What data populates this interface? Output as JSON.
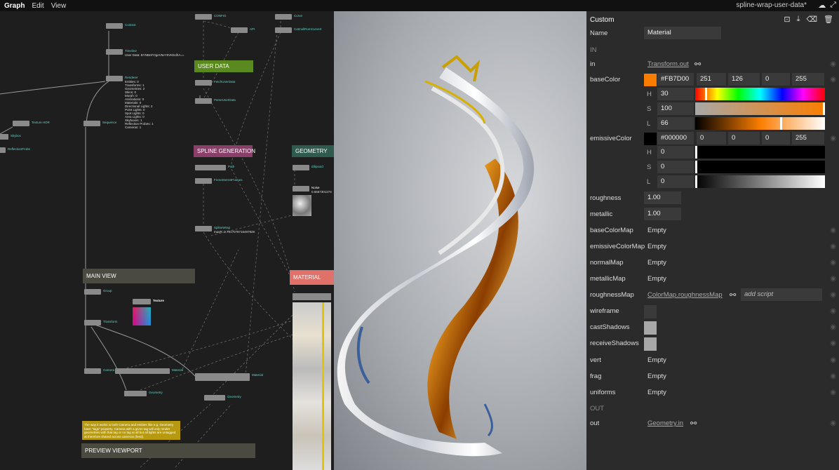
{
  "menu": {
    "graph": "Graph",
    "edit": "Edit",
    "view": "View"
  },
  "document_title": "spline-wrap-user-data*",
  "graph": {
    "groups": {
      "user_data": "USER DATA",
      "spline_generation": "SPLINE GENERATION",
      "geometry": "GEOMETRY",
      "main_view": "MAIN VIEW",
      "material": "MATERIAL",
      "preview_viewport": "PREVIEW VIEWPORT"
    },
    "nodes": {
      "context": "Context",
      "timeline": "Timeline",
      "timeline_info": "User Data: BYNBnFOgeV5eY6VKEdhA==",
      "renderer": "Renderer",
      "renderer_info": "Entities: 0\nTransforms: 1\nGeometries: 2\nSkins: 0\nMorph: 0\nAnimations: 0\nMaterials: 0\nDirectional Lights: 2\nPoint Lights: 0\nSpot Lights: 0\nArea Lights: 0\nSkyboxes: 1\nReflection Probes: 1\nCameras: 1",
      "sequence": "Sequence",
      "texture_hdr": "Texture HDR",
      "skybox": "Skybox",
      "reflection_probe": "ReflectionProbe",
      "config": "CONFIG",
      "api": "API",
      "curve": "Curve",
      "catmull": "CatmullRomCurve3",
      "fetch_user_data": "FetchUserData",
      "parse_user_data": "ParseUserData",
      "path": "Path",
      "frenet": "FrenetSerretFrames",
      "ellipsoid": "Ellipsoid",
      "noise": "Noise",
      "noise_info": "0.6567301274",
      "spline_wrap": "SplineWrap",
      "spline_info": "maxR: 0.7917078716497929",
      "group": "Group",
      "texture": "Texture",
      "transform": "Transform",
      "camera": "Camera",
      "material_node": "Material",
      "material_node2": "Material",
      "geometry_node": "Geometry",
      "geometry_node2": "Geometry"
    },
    "note": "The way it works is both Camera and entities like e.g. Geometry have \"tags\" property. Camera with a given tag will only render geometries with that tag or no tag at all but all lights are untagged at therefore shared across cameras (feed)."
  },
  "panel": {
    "title": "Custom",
    "rows": {
      "name_label": "Name",
      "name_value": "Material",
      "in_section": "IN",
      "in_label": "in",
      "in_link": "Transform.out",
      "basecolor_label": "baseColor",
      "basecolor_hex": "#FB7D00",
      "basecolor_r": "251",
      "basecolor_g": "126",
      "basecolor_b": "0",
      "basecolor_a": "255",
      "h_letter": "H",
      "s_letter": "S",
      "l_letter": "L",
      "basecolor_h": "30",
      "basecolor_s": "100",
      "basecolor_l": "66",
      "emissive_label": "emissiveColor",
      "emissive_hex": "#000000",
      "emissive_r": "0",
      "emissive_g": "0",
      "emissive_b": "0",
      "emissive_a": "255",
      "emissive_h": "0",
      "emissive_s": "0",
      "emissive_l": "0",
      "roughness_label": "roughness",
      "roughness_value": "1.00",
      "metallic_label": "metallic",
      "metallic_value": "1.00",
      "basecolormap_label": "baseColorMap",
      "basecolormap_value": "Empty",
      "emissivemap_label": "emissiveColorMap",
      "emissivemap_value": "Empty",
      "normalmap_label": "normalMap",
      "normalmap_value": "Empty",
      "metallicmap_label": "metallicMap",
      "metallicmap_value": "Empty",
      "roughnessmap_label": "roughnessMap",
      "roughnessmap_link": "ColorMap.roughnessMap",
      "script_placeholder": "add script",
      "wireframe_label": "wireframe",
      "castshadows_label": "castShadows",
      "receiveshadows_label": "receiveShadows",
      "vert_label": "vert",
      "vert_value": "Empty",
      "frag_label": "frag",
      "frag_value": "Empty",
      "uniforms_label": "uniforms",
      "uniforms_value": "Empty",
      "out_section": "OUT",
      "out_label": "out",
      "out_link": "Geometry.in"
    },
    "values": {
      "basecolor_hue_fraction": 0.083,
      "basecolor_sat_fraction": 1.0,
      "basecolor_light_fraction": 0.66,
      "emissive_fraction": 0.0
    }
  },
  "colors": {
    "base_color": "#FB7D00",
    "emissive_color": "#000000",
    "group_user_data": "#5a8a1f",
    "group_spline": "#8a3f6b",
    "group_geometry": "#2f5a4e",
    "group_main_view": "#4a4a40",
    "group_material": "#e0706a",
    "note_bg": "#b79a10"
  },
  "icons": {
    "cloud": "cloud-icon",
    "fullscreen": "fullscreen-icon",
    "fit": "fit-icon",
    "download": "download-icon",
    "erase": "erase-icon",
    "trash": "trash-icon",
    "link": "link-icon",
    "eye": "eye-icon"
  }
}
